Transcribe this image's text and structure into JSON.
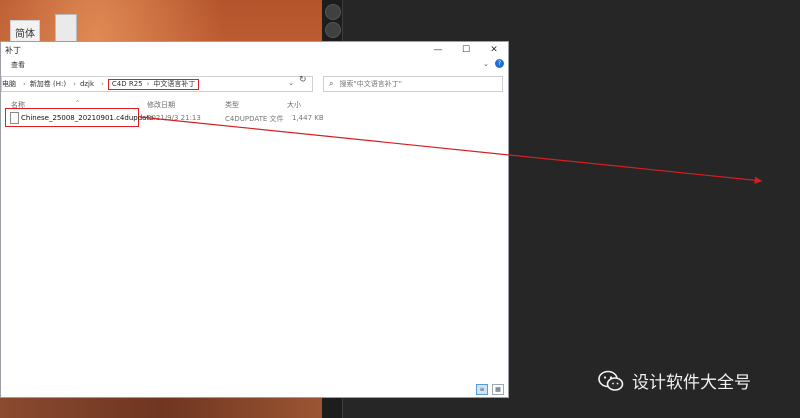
{
  "desktop": {
    "icon_label": "简体"
  },
  "window": {
    "title": "补丁",
    "controls": [
      "—",
      "☐",
      "✕"
    ],
    "ribbon_tab": "查看"
  },
  "address": {
    "crumbs": [
      "电脑",
      "新加卷 (H:)",
      "dzjk"
    ],
    "highlighted_crumbs": [
      "C4D R25",
      "中文语言补丁"
    ],
    "search_placeholder": "搜索\"中文语言补丁\""
  },
  "columns": {
    "name": "名称",
    "date": "修改日期",
    "type": "类型",
    "size": "大小"
  },
  "files": [
    {
      "name": "Chinese_25008_20210901.c4dupdate",
      "date": "2021/9/3 21:13",
      "type": "C4DUPDATE 文件",
      "size": "1,447 KB"
    }
  ],
  "watermark": {
    "text": "设计软件大全号"
  },
  "colors": {
    "highlight": "#e02020",
    "arrow": "#d42020"
  }
}
